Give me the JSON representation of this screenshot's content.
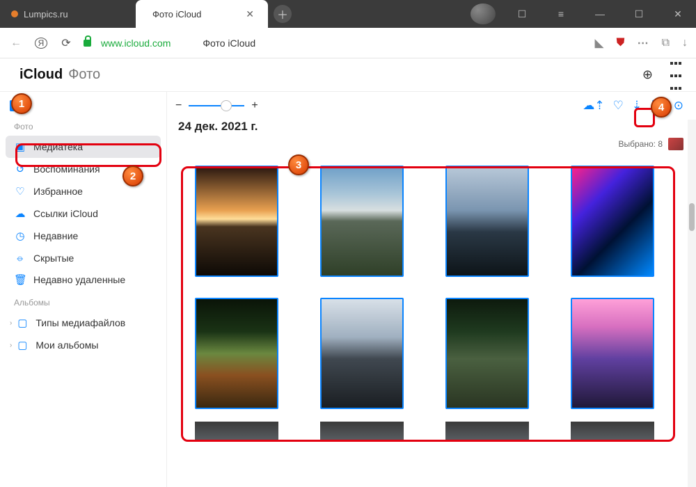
{
  "browser": {
    "tabs": [
      {
        "title": "Lumpics.ru"
      },
      {
        "title": "Фото iCloud"
      }
    ],
    "url": "www.icloud.com",
    "page_title": "Фото iCloud"
  },
  "icloud": {
    "brand": "iCloud",
    "app": "Фото"
  },
  "sidebar": {
    "section_photos": "Фото",
    "items": [
      {
        "label": "Медиатека"
      },
      {
        "label": "Воспоминания"
      },
      {
        "label": "Избранное"
      },
      {
        "label": "Ссылки iCloud"
      },
      {
        "label": "Недавние"
      },
      {
        "label": "Скрытые"
      },
      {
        "label": "Недавно удаленные"
      }
    ],
    "section_albums": "Альбомы",
    "albums": [
      {
        "label": "Типы медиафайлов"
      },
      {
        "label": "Мои альбомы"
      }
    ]
  },
  "content": {
    "date_heading": "24 дек. 2021 г.",
    "selected_label": "Выбрано: 8",
    "zoom_minus": "−",
    "zoom_plus": "+"
  },
  "annotations": {
    "m1": "1",
    "m2": "2",
    "m3": "3",
    "m4": "4"
  },
  "photos": {
    "gradients": [
      "linear-gradient(180deg,#2a1810 0%,#e8a050 40%,#ffdd99 48%,#4a3520 55%,#0d0905 100%)",
      "linear-gradient(180deg,#6fa0c8 0%,#a9c5d8 25%,#d8dfe0 40%,#5a6858 50%,#2f4028 100%)",
      "linear-gradient(180deg,#b8c8d8 0%,#7a95b0 40%,#2a3845 60%,#0d1418 100%)",
      "linear-gradient(135deg,#ff2288 0%,#4422dd 30%,#001133 60%,#0088ff 100%)",
      "linear-gradient(180deg,#0a1408 0%,#1a3315 30%,#6a8840 50%,#8a5020 70%,#3a2810 100%)",
      "linear-gradient(180deg,#d8e0e8 0%,#a0b0c0 35%,#404850 55%,#1a1e22 100%)",
      "linear-gradient(180deg,#0d1a0d 0%,#1f3a1f 30%,#4a6040 55%,#2a3522 100%)",
      "linear-gradient(180deg,#ffa0d8 0%,#d870c0 25%,#6040a0 55%,#201838 100%)"
    ]
  }
}
